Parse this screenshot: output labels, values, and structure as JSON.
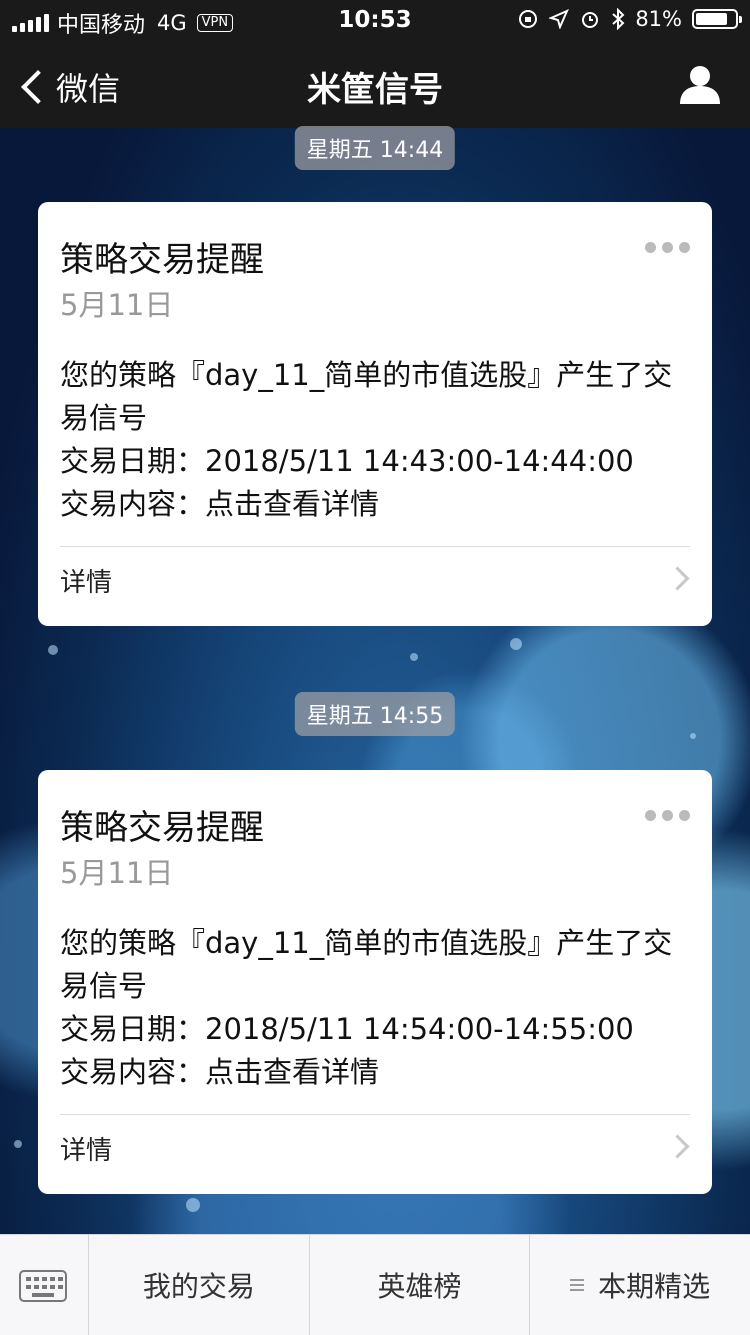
{
  "status_bar": {
    "carrier": "中国移动",
    "network": "4G",
    "vpn": "VPN",
    "time": "10:53",
    "battery_text": "81%",
    "battery_level": 0.81
  },
  "nav": {
    "back_label": "微信",
    "title": "米筐信号",
    "user_icon": "person-icon"
  },
  "messages": [
    {
      "timestamp": "星期五 14:44",
      "title": "策略交易提醒",
      "date": "5月11日",
      "lines": [
        "您的策略『day_11_简单的市值选股』产生了交易信号",
        "交易日期：2018/5/11 14:43:00-14:44:00",
        "交易内容：点击查看详情"
      ],
      "footer": "详情"
    },
    {
      "timestamp": "星期五 14:55",
      "title": "策略交易提醒",
      "date": "5月11日",
      "lines": [
        "您的策略『day_11_简单的市值选股』产生了交易信号",
        "交易日期：2018/5/11 14:54:00-14:55:00",
        "交易内容：点击查看详情"
      ],
      "footer": "详情"
    }
  ],
  "menu": {
    "keyboard_icon": "keyboard-icon",
    "items": [
      "我的交易",
      "英雄榜",
      "本期精选"
    ]
  },
  "colors": {
    "bar_bg": "#1a1a1a",
    "card_bg": "#ffffff",
    "date_gray": "#999999",
    "pill_bg": "#a0a0a5"
  }
}
